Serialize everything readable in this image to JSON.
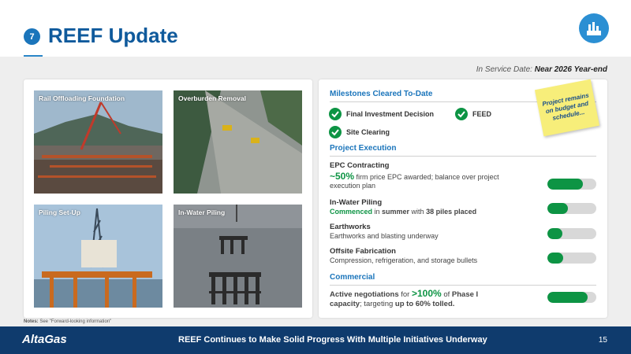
{
  "header": {
    "slide_number": "7",
    "title": "REEF Update"
  },
  "service_date": {
    "label": "In Service Date:",
    "value": "Near 2026 Year-end"
  },
  "photos": [
    {
      "caption": "Rail Offloading Foundation"
    },
    {
      "caption": "Overburden Removal"
    },
    {
      "caption": "Piling Set-Up"
    },
    {
      "caption": "In-Water Piling"
    }
  ],
  "milestones": {
    "heading": "Milestones Cleared To-Date",
    "items": [
      "Final Investment Decision",
      "FEED",
      "Site Clearing"
    ]
  },
  "project_execution": {
    "heading": "Project Execution",
    "items": [
      {
        "title": "EPC Contracting",
        "highlight": "~50%",
        "text": " firm price EPC awarded; balance over project execution plan",
        "progress": 0.72
      },
      {
        "title": "In-Water Piling",
        "highlight": "Commenced",
        "mid1": " in ",
        "bold1": "summer",
        "mid2": " with ",
        "bold2": "38 piles placed",
        "progress": 0.42
      },
      {
        "title": "Earthworks",
        "text": "Earthworks and blasting underway",
        "progress": 0.3
      },
      {
        "title": "Offsite Fabrication",
        "text": "Compression, refrigeration, and storage bullets",
        "progress": 0.33
      }
    ]
  },
  "commercial": {
    "heading": "Commercial",
    "pre": "Active negotiations",
    "for": " for ",
    "highlight": ">100%",
    "of": " of ",
    "phase": "Phase I capacity",
    "targeting": "; targeting ",
    "target": "up to 60% tolled.",
    "progress": 0.82
  },
  "sticky_note": "Project remains on budget and schedule...",
  "notes": {
    "label": "Notes:",
    "text": "See \"Forward-looking information\""
  },
  "footer": {
    "logo": "AltaGas",
    "text": "REEF Continues to Make Solid Progress With Multiple Initiatives Underway",
    "page": "15"
  },
  "colors": {
    "accent_blue": "#1b75bb",
    "green": "#0d9444",
    "footer": "#0f3b6d",
    "sticky": "#f7ee7a"
  }
}
